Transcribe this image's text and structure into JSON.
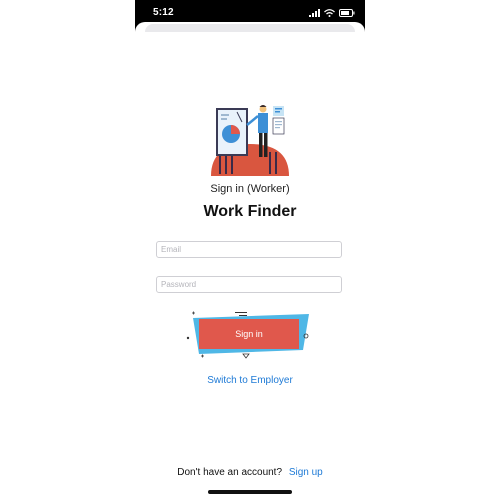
{
  "status_bar": {
    "time": "5:12",
    "icons": [
      "signal-icon",
      "wifi-icon",
      "battery-icon"
    ]
  },
  "header": {
    "subtitle": "Sign in (Worker)",
    "title": "Work Finder"
  },
  "form": {
    "email_placeholder": "Email",
    "password_placeholder": "Password",
    "signin_label": "Sign in"
  },
  "links": {
    "switch_label": "Switch to Employer"
  },
  "footer": {
    "prompt": "Don't have an account?",
    "signup_label": "Sign up"
  },
  "colors": {
    "accent": "#1e7ad6",
    "button": "#e0584c",
    "button_shadow": "#4fb7e6"
  }
}
